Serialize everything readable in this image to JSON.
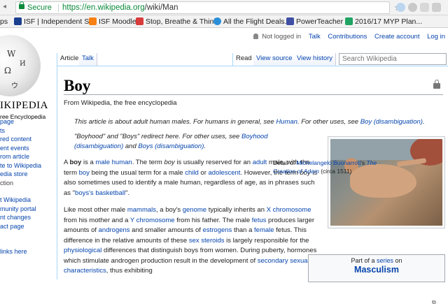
{
  "browser": {
    "secure_label": "Secure",
    "url_host": "https://en.wikipedia.org",
    "url_path": "/wiki/Man",
    "bookmarks": [
      {
        "label": "ps",
        "icon": "none",
        "color": "#f2f2f2"
      },
      {
        "label": "ISF | Independent S...",
        "icon": "school-icon",
        "color": "#1b3f8f"
      },
      {
        "label": "ISF Moodle",
        "icon": "moodle-icon",
        "color": "#f98012"
      },
      {
        "label": "Stop, Breathe & Think",
        "icon": "meditation-icon",
        "color": "#d93a3a"
      },
      {
        "label": "All the Flight Deals...",
        "icon": "flight-icon",
        "color": "#2b8fd9"
      },
      {
        "label": "PowerTeacher",
        "icon": "powerteacher-icon",
        "color": "#3f4fa3"
      },
      {
        "label": "2016/17 MYP Plan...",
        "icon": "sheets-icon",
        "color": "#1fa463"
      }
    ]
  },
  "logo": {
    "wordmark": "IKIPEDIA",
    "tagline": "ree Encyclopedia"
  },
  "sidebar": {
    "items": [
      "page",
      "ts",
      "red content",
      "ent events",
      "rom article",
      "te to Wikipedia",
      "edia store",
      "",
      "ction",
      "",
      "t Wikipedia",
      "munity portal",
      "nt changes",
      "act page",
      "",
      "",
      "",
      "links here"
    ]
  },
  "personal": {
    "not_logged": "Not logged in",
    "talk": "Talk",
    "contributions": "Contributions",
    "create": "Create account",
    "login": "Log in"
  },
  "tabs": {
    "article": "Article",
    "talk": "Talk",
    "read": "Read",
    "view_source": "View source",
    "view_history": "View history"
  },
  "search": {
    "placeholder": "Search Wikipedia"
  },
  "article": {
    "title": "Boy",
    "from": "From Wikipedia, the free encyclopedia",
    "hatnote1": {
      "pre": "This article is about adult human males. For humans in general, see ",
      "link1": "Human",
      "mid": ". For other uses, see ",
      "link2": "Boy (disambiguation)",
      "post": "."
    },
    "hatnote2": {
      "pre": "\"Boyhood\" and \"Boys\" redirect here. For other uses, see ",
      "link1": "Boyhood (disambiguation)",
      "mid": " and ",
      "link2": "Boys (disambiguation)",
      "post": "."
    },
    "p1": [
      "A ",
      "boy",
      " is a ",
      "male",
      " ",
      "human",
      ". The term ",
      "boy",
      " is usually reserved for an ",
      "adult",
      " male, with the term ",
      "boy",
      " being the usual term for a male ",
      "child",
      " or ",
      "adolescent",
      ". However, the term ",
      "boy",
      " is also sometimes used to identify a male human, regardless of age, as in phrases such as \"",
      "boys's basketball",
      "\"."
    ],
    "p2": [
      "Like most other male ",
      "mammals",
      ", a boy's ",
      "genome",
      " typically inherits an ",
      "X chromosome",
      " from his mother and a ",
      "Y chromosome",
      " from his father. The male ",
      "fetus",
      " produces larger amounts of ",
      "androgens",
      " and smaller amounts of ",
      "estrogens",
      " than a ",
      "female",
      " fetus. This difference in the relative amounts of these ",
      "sex steroids",
      " is largely responsible for the ",
      "physiological",
      " differences that distinguish boys from women. During puberty, hormones which stimulate androgen production result in the development of ",
      "secondary sexual characteristics",
      ", thus exhibiting"
    ]
  },
  "infobox": {
    "caption_pre": "Detail of ",
    "caption_link1": "Michelangelo Buonarroti",
    "caption_mid": "'s ",
    "caption_link2": "The Creation of Adam",
    "caption_post": " (circa 1511)"
  },
  "series_box": {
    "line1_pre": "Part of a ",
    "line1_link": "series",
    "line1_post": " on",
    "title": "Masculism"
  }
}
